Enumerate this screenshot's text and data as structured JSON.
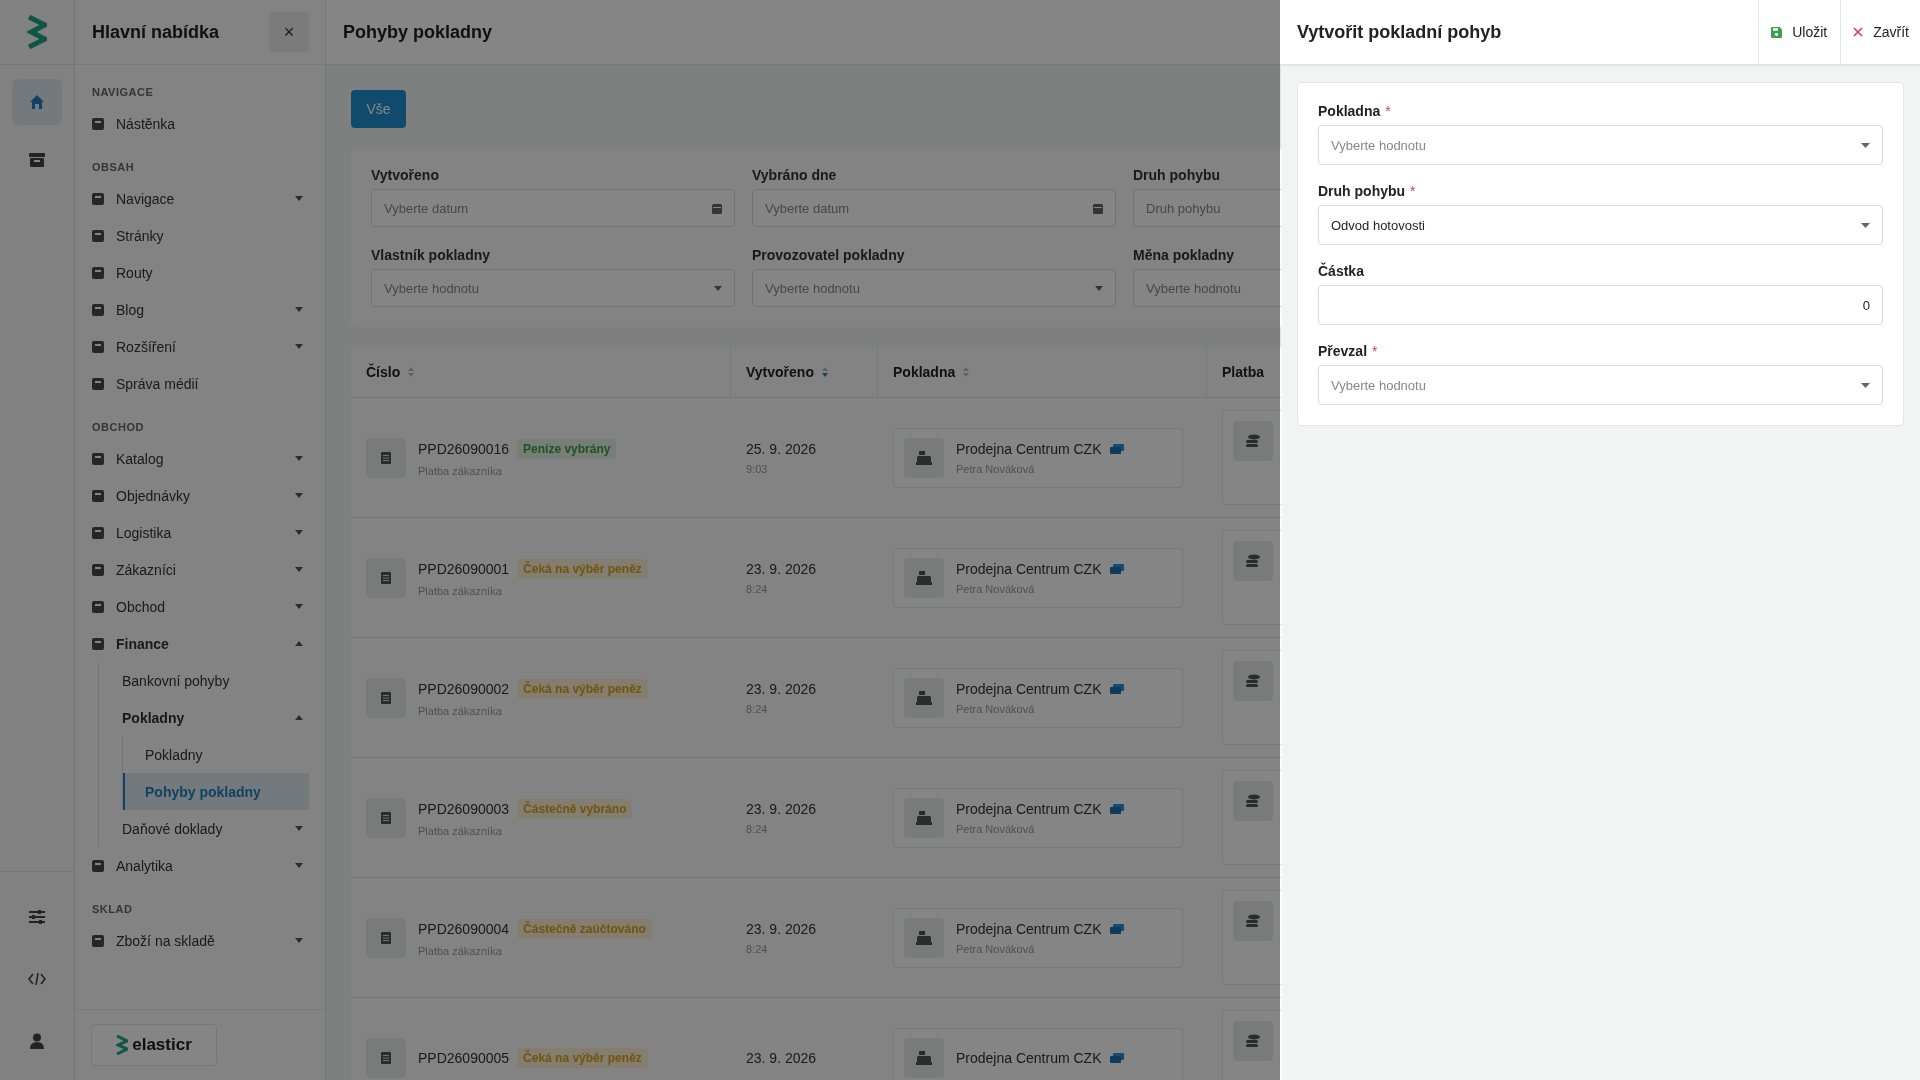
{
  "rail": {
    "top": [
      {
        "selected": true
      },
      {
        "selected": false
      }
    ],
    "bottom": [
      {
        "selected": false
      },
      {
        "selected": false
      },
      {
        "selected": false
      }
    ]
  },
  "sidebar": {
    "title": "Hlavní nabídka",
    "close": "×",
    "brand": "elasticr",
    "sections": [
      {
        "heading": "NAVIGACE",
        "items": [
          {
            "label": "Nástěnka",
            "selected": false
          }
        ]
      },
      {
        "heading": "OBSAH",
        "items": [
          {
            "label": "Navigace",
            "selected": false,
            "expanded": false
          },
          {
            "label": "Stránky",
            "selected": false
          },
          {
            "label": "Routy",
            "selected": false
          },
          {
            "label": "Blog",
            "selected": false,
            "expanded": false
          },
          {
            "label": "Rozšíření",
            "selected": false,
            "expanded": false
          },
          {
            "label": "Správa médií",
            "selected": false
          }
        ]
      },
      {
        "heading": "OBCHOD",
        "items": [
          {
            "label": "Katalog",
            "selected": false,
            "expanded": false
          },
          {
            "label": "Objednávky",
            "selected": false,
            "expanded": false
          },
          {
            "label": "Logistika",
            "selected": false,
            "expanded": false
          },
          {
            "label": "Zákazníci",
            "selected": false,
            "expanded": false
          },
          {
            "label": "Obchod",
            "selected": false,
            "expanded": false
          },
          {
            "label": "Finance",
            "selected": false,
            "expanded": true,
            "children": [
              {
                "label": "Bankovní pohyby",
                "selected": false
              },
              {
                "label": "Pokladny",
                "selected": false,
                "expanded": true,
                "children": [
                  {
                    "label": "Pokladny",
                    "selected": false
                  },
                  {
                    "label": "Pohyby pokladny",
                    "selected": true
                  }
                ]
              },
              {
                "label": "Daňové doklady",
                "selected": false,
                "expanded": false
              }
            ]
          },
          {
            "label": "Analytika",
            "selected": false,
            "expanded": false
          }
        ]
      },
      {
        "heading": "SKLAD",
        "items": [
          {
            "label": "Zboží na skladě",
            "selected": false,
            "expanded": false
          }
        ]
      }
    ]
  },
  "main": {
    "title": "Pohyby pokladny",
    "filter_tab": "Vše",
    "filters": [
      {
        "label": "Vytvořeno",
        "placeholder": "Vyberte datum",
        "kind": "date"
      },
      {
        "label": "Vybráno dne",
        "placeholder": "Vyberte datum",
        "kind": "date"
      },
      {
        "label": "Druh pohybu",
        "placeholder": "Druh pohybu",
        "kind": "text"
      },
      {
        "label": "Vlastník pokladny",
        "placeholder": "Vyberte hodnotu",
        "kind": "select"
      },
      {
        "label": "Provozovatel pokladny",
        "placeholder": "Vyberte hodnotu",
        "kind": "select"
      },
      {
        "label": "Měna pokladny",
        "placeholder": "Vyberte hodnotu",
        "kind": "text"
      }
    ],
    "table": {
      "columns": [
        {
          "label": "Číslo",
          "sorted": false
        },
        {
          "label": "Vytvořeno",
          "sorted": true
        },
        {
          "label": "Pokladna",
          "sorted": false
        },
        {
          "label": "Platba"
        }
      ],
      "rows": [
        {
          "number": "PPD26090016",
          "status": {
            "text": "Peníze vybrány",
            "kind": "success"
          },
          "subtitle": "Platba zákazníka",
          "date": "25. 9. 2026",
          "time": "9:03",
          "register": "Prodejna Centrum CZK",
          "owner": "Petra Nováková"
        },
        {
          "number": "PPD26090001",
          "status": {
            "text": "Čeká na výběr peněz",
            "kind": "warning"
          },
          "subtitle": "Platba zákazníka",
          "date": "23. 9. 2026",
          "time": "8:24",
          "register": "Prodejna Centrum CZK",
          "owner": "Petra Nováková"
        },
        {
          "number": "PPD26090002",
          "status": {
            "text": "Čeká na výběr peněz",
            "kind": "warning"
          },
          "subtitle": "Platba zákazníka",
          "date": "23. 9. 2026",
          "time": "8:24",
          "register": "Prodejna Centrum CZK",
          "owner": "Petra Nováková"
        },
        {
          "number": "PPD26090003",
          "status": {
            "text": "Částečně vybráno",
            "kind": "warning"
          },
          "subtitle": "Platba zákazníka",
          "date": "23. 9. 2026",
          "time": "8:24",
          "register": "Prodejna Centrum CZK",
          "owner": "Petra Nováková"
        },
        {
          "number": "PPD26090004",
          "status": {
            "text": "Částečně zaúčtováno",
            "kind": "warning"
          },
          "subtitle": "Platba zákazníka",
          "date": "23. 9. 2026",
          "time": "8:24",
          "register": "Prodejna Centrum CZK",
          "owner": "Petra Nováková"
        },
        {
          "number": "PPD26090005",
          "status": {
            "text": "Čeká na výběr peněz",
            "kind": "warning"
          },
          "date": "23. 9. 2026",
          "register": "Prodejna Centrum CZK"
        }
      ]
    }
  },
  "drawer": {
    "title": "Vytvořit pokladní pohyb",
    "required_mark": "*",
    "actions": [
      {
        "label": "Uložit",
        "kind": "save"
      },
      {
        "label": "Zavřít",
        "kind": "close"
      }
    ],
    "fields": [
      {
        "label": "Pokladna",
        "required": true,
        "kind": "select",
        "placeholder": "Vyberte hodnotu"
      },
      {
        "label": "Druh pohybu",
        "required": true,
        "kind": "select",
        "value": "Odvod hotovosti"
      },
      {
        "label": "Částka",
        "required": false,
        "kind": "number",
        "value": "0"
      },
      {
        "label": "Převzal",
        "required": true,
        "kind": "select",
        "placeholder": "Vyberte hodnotu"
      }
    ]
  }
}
